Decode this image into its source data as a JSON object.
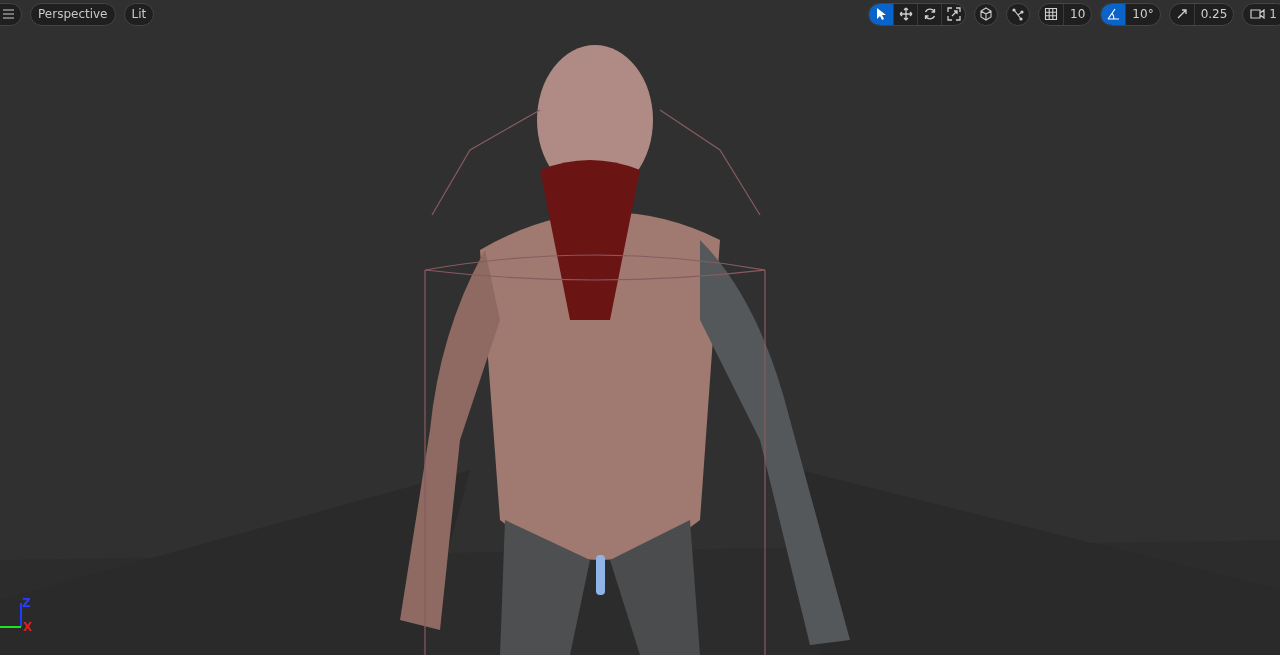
{
  "viewport": {
    "view_mode": "Perspective",
    "lighting": "Lit"
  },
  "transform_tools": [
    {
      "kind": "select",
      "selected": true
    },
    {
      "kind": "move",
      "selected": false
    },
    {
      "kind": "rotate",
      "selected": false
    },
    {
      "kind": "scale",
      "selected": false
    }
  ],
  "snap_toggles": [
    {
      "kind": "grid",
      "value": "10",
      "on": false
    },
    {
      "kind": "angle",
      "value": "10°",
      "on": true
    },
    {
      "kind": "scale",
      "value": "0.25",
      "on": false
    }
  ],
  "camera_speed": "1",
  "axis_labels": [
    {
      "kind": "z",
      "label": "Z"
    },
    {
      "kind": "x",
      "label": "X"
    }
  ]
}
